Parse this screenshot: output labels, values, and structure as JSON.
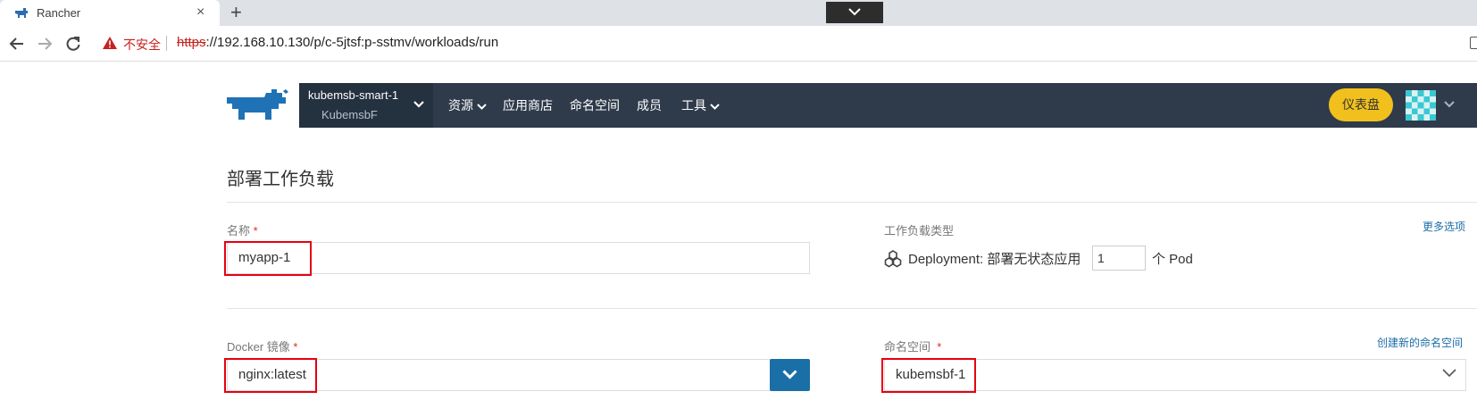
{
  "browser": {
    "tab_title": "Rancher",
    "tab_close": "×",
    "new_tab": "+",
    "security_warning": "不安全",
    "url_scheme": "https",
    "url_rest": "://192.168.10.130/p/c-5jtsf:p-sstmv/workloads/run"
  },
  "header": {
    "cluster_name": "kubemsb-smart-1",
    "project_name": "KubemsbF",
    "nav": {
      "resources": "资源",
      "app_store": "应用商店",
      "namespaces": "命名空间",
      "members": "成员",
      "tools": "工具"
    },
    "dashboard_button": "仪表盘"
  },
  "page": {
    "title": "部署工作负载",
    "name_label": "名称",
    "required_mark": "*",
    "name_value": "myapp-1",
    "workload_type_label": "工作负载类型",
    "more_options_link": "更多选项",
    "deployment_text": "Deployment: 部署无状态应用",
    "scale_value": "1",
    "pod_text": "个 Pod",
    "docker_image_label": "Docker 镜像",
    "docker_image_value": "nginx:latest",
    "namespace_label": "命名空间",
    "create_namespace_link": "创建新的命名空间",
    "namespace_value": "kubemsbf-1"
  },
  "colors": {
    "navbar_bg": "#2f3b4b",
    "dashboard_button": "#f1c01c",
    "highlight_border": "#e50012",
    "primary_button": "#1a6fa7"
  }
}
